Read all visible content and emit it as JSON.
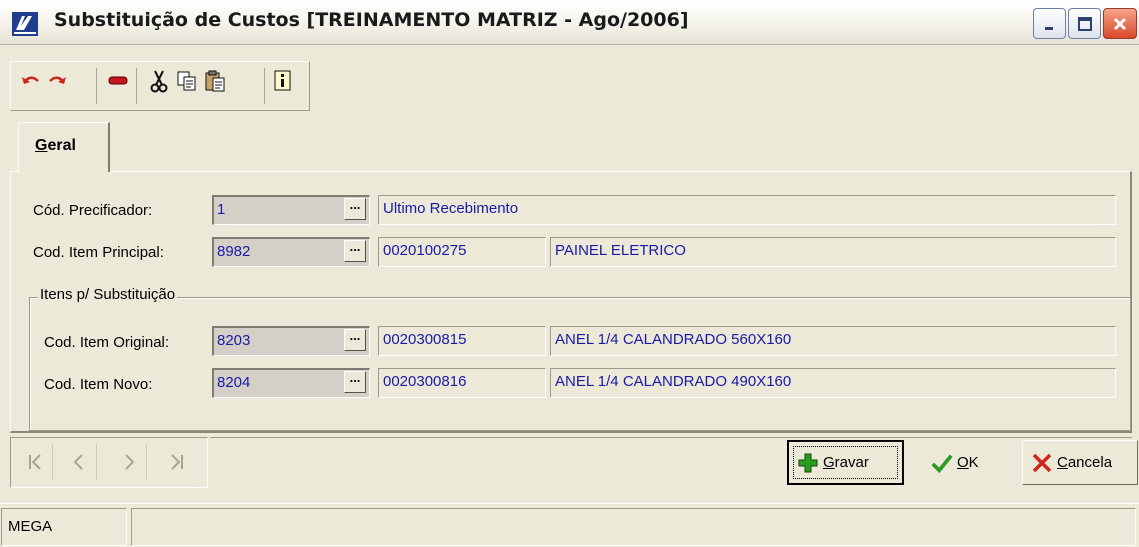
{
  "window": {
    "title": "Substituição de Custos [TREINAMENTO MATRIZ - Ago/2006]",
    "icons": [
      "app-logo-icon",
      "minimize-icon",
      "maximize-icon",
      "close-icon"
    ]
  },
  "toolbar": {
    "buttons": [
      "undo-icon",
      "redo-icon",
      "delete-icon",
      "cut-icon",
      "copy-icon",
      "paste-icon",
      "info-icon"
    ]
  },
  "tabs": [
    {
      "label_pre": "G",
      "label_rest": "eral"
    }
  ],
  "form": {
    "precificador": {
      "label": "Cód. Precificador:",
      "code": "1",
      "desc": "Ultimo Recebimento"
    },
    "item_principal": {
      "label": "Cod. Item Principal:",
      "code": "8982",
      "ref": "0020100275",
      "desc": "PAINEL ELETRICO"
    },
    "group_title": "Itens p/ Substituição",
    "item_original": {
      "label": "Cod. Item Original:",
      "code": "8203",
      "ref": "0020300815",
      "desc": "ANEL 1/4 CALANDRADO 560X160"
    },
    "item_novo": {
      "label": "Cod. Item Novo:",
      "code": "8204",
      "ref": "0020300816",
      "desc": "ANEL 1/4 CALANDRADO 490X160"
    },
    "ellipsis": "..."
  },
  "navigation": [
    "first-record-icon",
    "prev-record-icon",
    "next-record-icon",
    "last-record-icon"
  ],
  "actions": {
    "gravar": {
      "accel": "G",
      "rest": "ravar",
      "icon": "plus-icon"
    },
    "ok": {
      "accel": "O",
      "rest": "K",
      "icon": "check-icon"
    },
    "cancela": {
      "accel": "C",
      "rest": "ancela",
      "icon": "x-icon"
    }
  },
  "status": {
    "left": "MEGA"
  },
  "colors": {
    "value_text": "#1a1aa8",
    "face": "#ece9d8",
    "accent_red": "#d2261a",
    "accent_green": "#2a9d1f"
  }
}
